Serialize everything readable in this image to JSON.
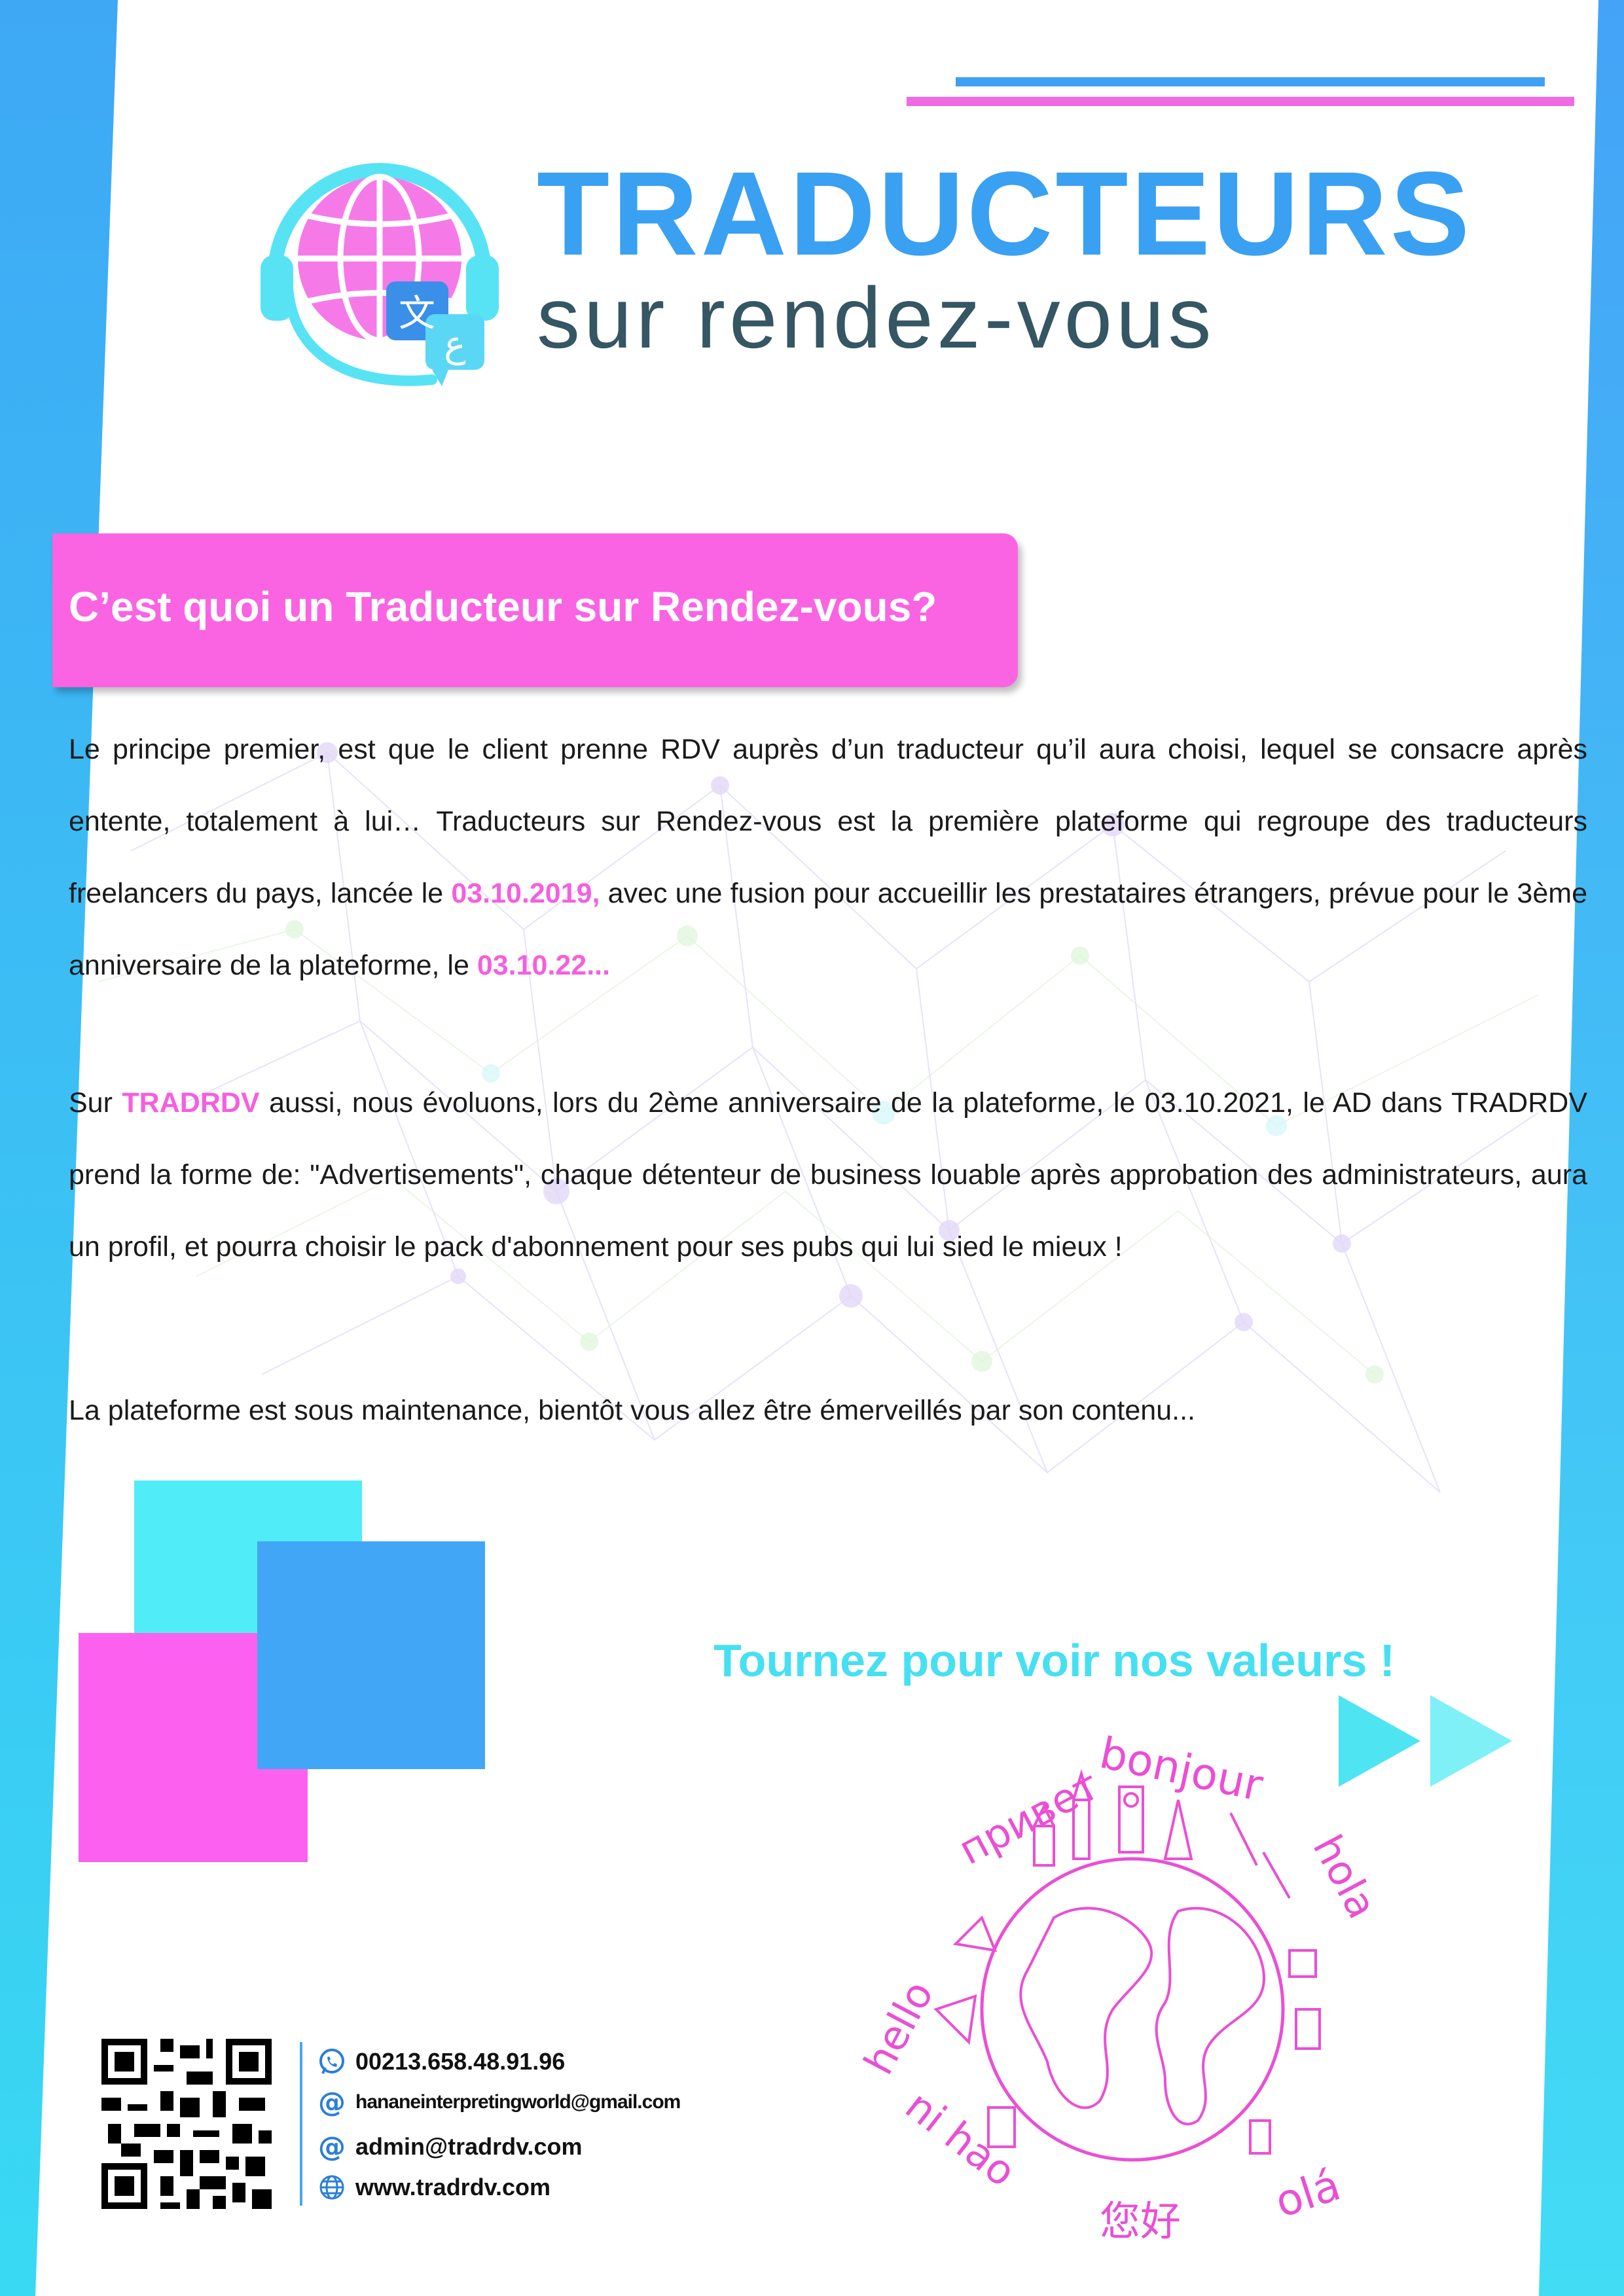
{
  "brand": {
    "title": "TRADUCTEURS",
    "subtitle": "sur rendez-vous",
    "logo_glyph_1": "文",
    "logo_glyph_2": "ع",
    "colors": {
      "pink": "#fa63e2",
      "blue": "#3aa0f2",
      "cyan": "#50ecf7",
      "dark": "#355663"
    }
  },
  "banner": {
    "title": "C’est quoi un Traducteur sur Rendez-vous?"
  },
  "p1": {
    "a": "Le principe premier, est que le client prenne RDV auprès d’un traducteur qu’il aura choisi, lequel se consacre après entente, totalement à lui… Traducteurs sur Rendez-vous est la première plateforme qui regroupe des traducteurs freelancers du pays, lancée le ",
    "date1": "03.10.2019,",
    "b": " avec une fusion pour accueillir les prestataires étrangers, prévue pour le 3ème anniversaire de la plateforme, le ",
    "date2": "03.10.22..."
  },
  "p2": {
    "a": "Sur ",
    "brand": "TRADRDV",
    "b": " aussi, nous évoluons, lors du 2ème anniversaire de la plateforme, le 03.10.2021, le AD dans TRADRDV prend la forme de: \"Advertisements\", chaque détenteur de business louable après approbation des administrateurs, aura un profil, et pourra choisir le pack d'abonnement pour ses pubs qui lui sied le mieux !"
  },
  "p3": {
    "text": "La plateforme est sous maintenance, bientôt vous allez être émerveillés par son contenu..."
  },
  "values": {
    "title": "Tournez pour voir nos valeurs !"
  },
  "greetings": {
    "hello": "hello",
    "privet": "привет",
    "bonjour": "bonjour",
    "hola": "hola",
    "nihao": "ni hao",
    "ola": "olá",
    "chinese": "您好"
  },
  "contacts": {
    "phone": "00213.658.48.91.96",
    "email1": "hananeinterpretingworld@gmail.com",
    "email2": "admin@tradrdv.com",
    "website": "www.tradrdv.com",
    "icons": [
      "whatsapp-icon",
      "at-icon",
      "at-icon",
      "globe-icon"
    ]
  }
}
